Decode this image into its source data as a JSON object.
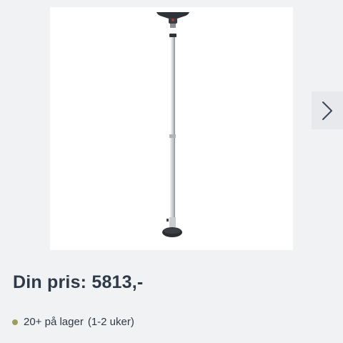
{
  "product": {
    "image_alt": "patio-heater-pole",
    "next_icon": "chevron-right-icon"
  },
  "price": {
    "text": "Din pris: 5813,-"
  },
  "stock": {
    "status_color": "#9aa05b",
    "quantity_text": "20+ på lager",
    "delivery_text": "(1-2 uker)"
  },
  "colors": {
    "background": "#f1f2f4",
    "text": "#2e3a47",
    "accent_dot": "#9aa05b"
  }
}
